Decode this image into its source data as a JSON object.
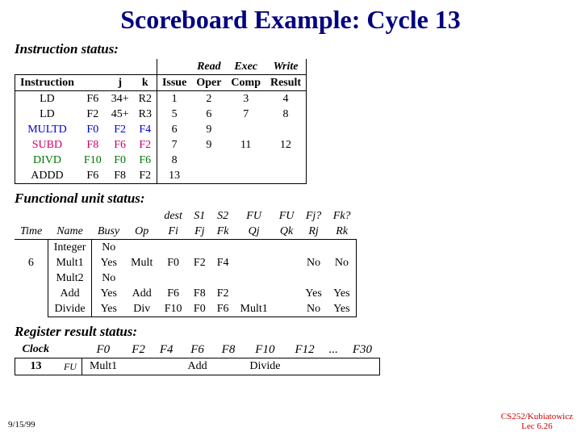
{
  "title": "Scoreboard Example: Cycle 13",
  "labels": {
    "instr_status": "Instruction status:",
    "fu_status": "Functional unit status:",
    "rr_status": "Register result status:"
  },
  "instr": {
    "sup": {
      "read": "Read",
      "exec": "Exec",
      "write": "Write"
    },
    "hdr": {
      "instruction": "Instruction",
      "j": "j",
      "k": "k",
      "issue": "Issue",
      "oper": "Oper",
      "comp": "Comp",
      "result": "Result"
    },
    "rows": [
      {
        "cls": "ld",
        "op": "LD",
        "dst": "F6",
        "j": "34+",
        "k": "R2",
        "issue": "1",
        "oper": "2",
        "comp": "3",
        "result": "4"
      },
      {
        "cls": "ld",
        "op": "LD",
        "dst": "F2",
        "j": "45+",
        "k": "R3",
        "issue": "5",
        "oper": "6",
        "comp": "7",
        "result": "8"
      },
      {
        "cls": "mul",
        "op": "MULTD",
        "dst": "F0",
        "j": "F2",
        "k": "F4",
        "issue": "6",
        "oper": "9",
        "comp": "",
        "result": ""
      },
      {
        "cls": "sub",
        "op": "SUBD",
        "dst": "F8",
        "j": "F6",
        "k": "F2",
        "issue": "7",
        "oper": "9",
        "comp": "11",
        "result": "12"
      },
      {
        "cls": "divv",
        "op": "DIVD",
        "dst": "F10",
        "j": "F0",
        "k": "F6",
        "issue": "8",
        "oper": "",
        "comp": "",
        "result": ""
      },
      {
        "cls": "add",
        "op": "ADDD",
        "dst": "F6",
        "j": "F8",
        "k": "F2",
        "issue": "13",
        "oper": "",
        "comp": "",
        "result": ""
      }
    ]
  },
  "fu": {
    "hdr": {
      "time": "Time",
      "name": "Name",
      "busy": "Busy",
      "op": "Op",
      "dest": "dest",
      "fi": "Fi",
      "s1": "S1",
      "fj": "Fj",
      "s2": "S2",
      "fk": "Fk",
      "fuqj": "FU",
      "qj": "Qj",
      "fuqk": "FU",
      "qk": "Qk",
      "fjq": "Fj?",
      "rj": "Rj",
      "fkq": "Fk?",
      "rk": "Rk"
    },
    "rows": [
      {
        "time": "",
        "name": "Integer",
        "busy": "No",
        "op": "",
        "fi": "",
        "fj": "",
        "fk": "",
        "qj": "",
        "qk": "",
        "rj": "",
        "rk": ""
      },
      {
        "time": "6",
        "name": "Mult1",
        "busy": "Yes",
        "op": "Mult",
        "fi": "F0",
        "fj": "F2",
        "fk": "F4",
        "qj": "",
        "qk": "",
        "rj": "No",
        "rk": "No"
      },
      {
        "time": "",
        "name": "Mult2",
        "busy": "No",
        "op": "",
        "fi": "",
        "fj": "",
        "fk": "",
        "qj": "",
        "qk": "",
        "rj": "",
        "rk": ""
      },
      {
        "time": "",
        "name": "Add",
        "busy": "Yes",
        "op": "Add",
        "fi": "F6",
        "fj": "F8",
        "fk": "F2",
        "qj": "",
        "qk": "",
        "rj": "Yes",
        "rk": "Yes"
      },
      {
        "time": "",
        "name": "Divide",
        "busy": "Yes",
        "op": "Div",
        "fi": "F10",
        "fj": "F0",
        "fk": "F6",
        "qj": "Mult1",
        "qk": "",
        "rj": "No",
        "rk": "Yes"
      }
    ]
  },
  "rr": {
    "clock_label": "Clock",
    "clock": "13",
    "fu_label": "FU",
    "hdr": [
      "F0",
      "F2",
      "F4",
      "F6",
      "F8",
      "F10",
      "F12",
      "...",
      "F30"
    ],
    "vals": [
      "Mult1",
      "",
      "",
      "Add",
      "",
      "Divide",
      "",
      "",
      ""
    ]
  },
  "footer": {
    "date": "9/15/99",
    "line1": "CS252/Kubiatowicz",
    "line2": "Lec 6.26"
  }
}
